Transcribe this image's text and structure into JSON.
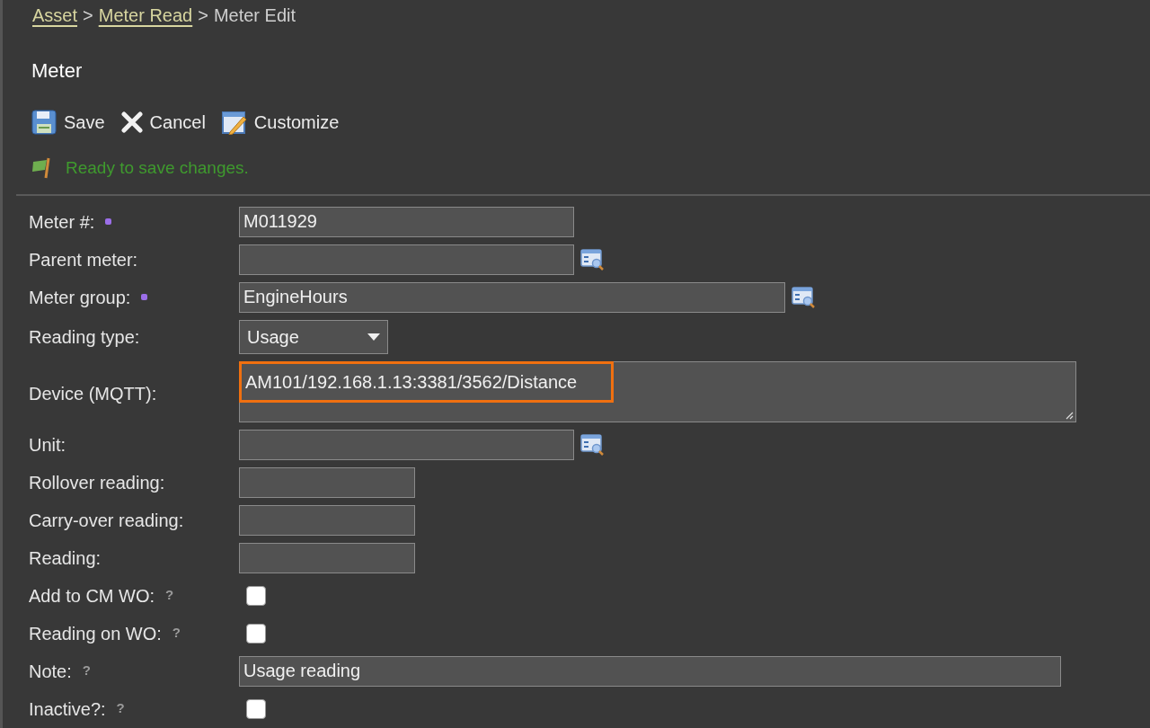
{
  "breadcrumbs": [
    {
      "label": "Asset",
      "kind": "link"
    },
    {
      "label": "Meter Read",
      "kind": "link"
    },
    {
      "label": "Meter Edit",
      "kind": "current"
    }
  ],
  "breadcrumb_separator": ">",
  "title": "Meter",
  "toolbar": [
    {
      "label": "Save",
      "kind": "save"
    },
    {
      "label": "Cancel",
      "kind": "cancel"
    },
    {
      "label": "Customize",
      "kind": "customize"
    }
  ],
  "status": "Ready to save changes.",
  "fields": [
    {
      "label": "Meter #:",
      "required": true,
      "kind": "text",
      "value": "M011929"
    },
    {
      "label": "Parent meter:",
      "required": false,
      "kind": "lookup"
    },
    {
      "label": "Meter group:",
      "required": true,
      "kind": "lookup",
      "value": "EngineHours"
    },
    {
      "label": "Reading type:",
      "required": false,
      "kind": "select",
      "value": "Usage"
    },
    {
      "label": "Device (MQTT):",
      "required": false,
      "kind": "textarea",
      "value": "AM101/192.168.1.13:3381/3562/Distance",
      "highlighted": true
    },
    {
      "label": "Unit:",
      "required": false,
      "kind": "lookup"
    },
    {
      "label": "Rollover reading:",
      "required": false,
      "kind": "text"
    },
    {
      "label": "Carry-over reading:",
      "required": false,
      "kind": "text"
    },
    {
      "label": "Reading:",
      "required": false,
      "kind": "text"
    },
    {
      "label": "Add to CM WO:",
      "required": false,
      "help": "?",
      "kind": "checkbox",
      "checked": false
    },
    {
      "label": "Reading on WO:",
      "required": false,
      "help": "?",
      "kind": "checkbox",
      "checked": false
    },
    {
      "label": "Note:",
      "required": false,
      "help": "?",
      "kind": "text",
      "value": "Usage reading"
    },
    {
      "label": "Inactive?:",
      "required": false,
      "help": "?",
      "kind": "checkbox",
      "checked": false
    }
  ]
}
